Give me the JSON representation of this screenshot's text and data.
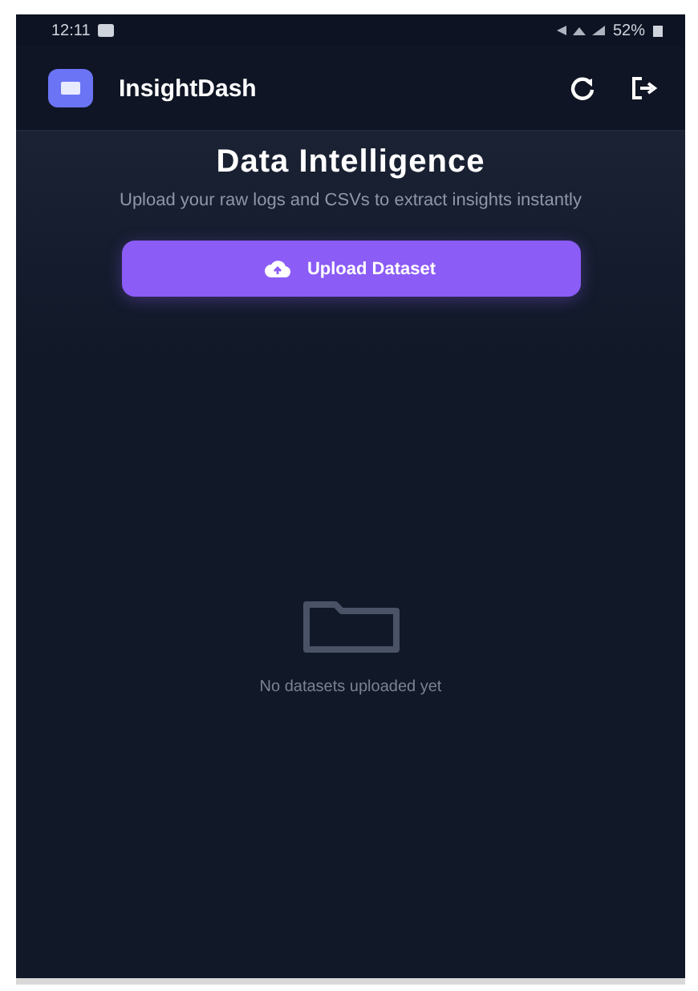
{
  "status_bar": {
    "time": "12:11",
    "battery": "52%"
  },
  "header": {
    "app_name": "InsightDash"
  },
  "hero": {
    "title": "Data Intelligence",
    "subtitle": "Upload your raw logs and CSVs to extract insights instantly",
    "button": "Upload Dataset"
  },
  "empty_state": {
    "message": "No datasets uploaded yet"
  }
}
